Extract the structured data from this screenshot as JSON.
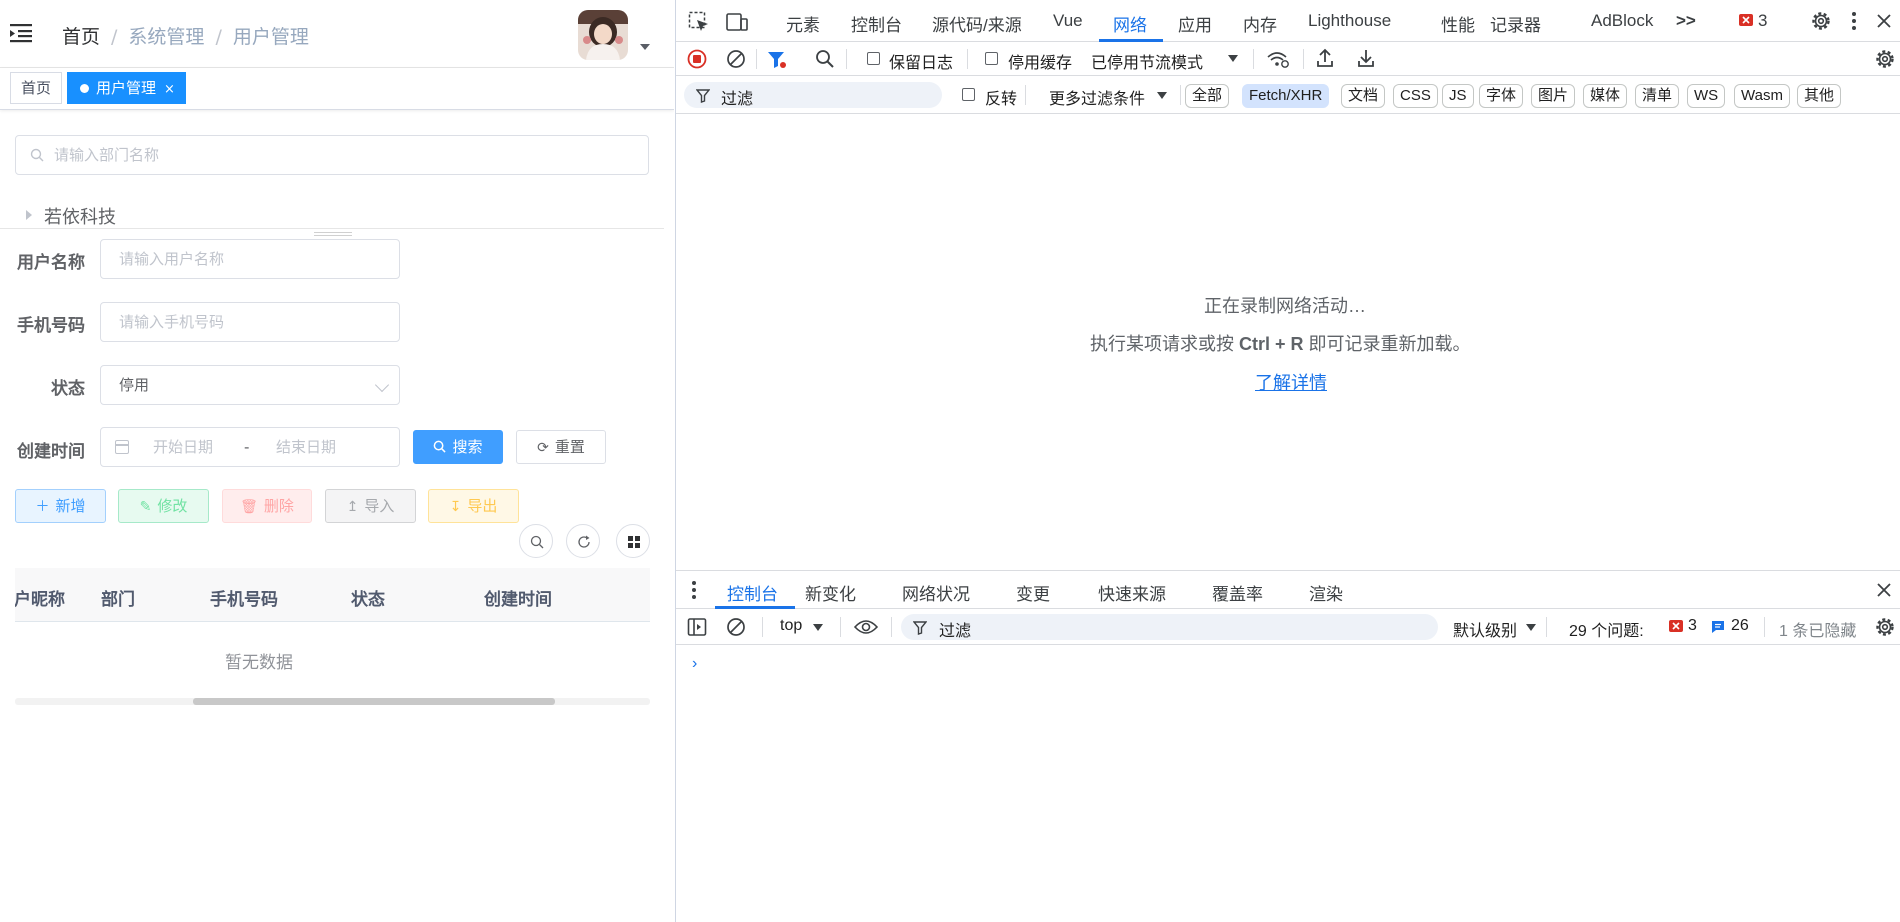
{
  "navbar": {
    "breadcrumb": [
      "首页",
      "系统管理",
      "用户管理"
    ]
  },
  "tags": {
    "home": "首页",
    "active": "用户管理",
    "close": "×"
  },
  "dept": {
    "search_placeholder": "请输入部门名称",
    "tree_root": "若依科技"
  },
  "form": {
    "username_label": "用户名称",
    "username_placeholder": "请输入用户名称",
    "phone_label": "手机号码",
    "phone_placeholder": "请输入手机号码",
    "status_label": "状态",
    "status_value": "停用",
    "created_label": "创建时间",
    "start_placeholder": "开始日期",
    "range_sep": "-",
    "end_placeholder": "结束日期",
    "search_button": "搜索",
    "reset_button": "重置"
  },
  "actions": {
    "add": "新增",
    "edit": "修改",
    "delete": "删除",
    "import": "导入",
    "export": "导出"
  },
  "table": {
    "columns": [
      "用户昵称",
      "部门",
      "手机号码",
      "状态",
      "创建时间"
    ],
    "empty_text": "暂无数据"
  },
  "devtools": {
    "tabs": [
      "元素",
      "控制台",
      "源代码/来源",
      "Vue",
      "网络",
      "应用",
      "内存",
      "Lighthouse",
      "性能",
      "记录器",
      "AdBlock"
    ],
    "active_tab": "网络",
    "more_tabs": ">>",
    "error_count": "3",
    "toolbar": {
      "preserve_log": "保留日志",
      "disable_cache": "停用缓存",
      "throttle": "已停用节流模式"
    },
    "filter": {
      "placeholder": "过滤",
      "invert": "反转",
      "more_filters": "更多过滤条件",
      "chips": [
        "全部",
        "Fetch/XHR",
        "文档",
        "CSS",
        "JS",
        "字体",
        "图片",
        "媒体",
        "清单",
        "WS",
        "Wasm",
        "其他"
      ],
      "active_chip": "Fetch/XHR"
    },
    "network_empty": {
      "line1": "正在录制网络活动…",
      "line2_pre": "执行某项请求或按 ",
      "line2_key": "Ctrl + R",
      "line2_post": " 即可记录重新加载。",
      "link": "了解详情"
    },
    "drawer": {
      "tabs": [
        "控制台",
        "新变化",
        "网络状况",
        "变更",
        "快速来源",
        "覆盖率",
        "渲染"
      ],
      "active_tab": "控制台",
      "context": "top",
      "filter_placeholder": "过滤",
      "level": "默认级别",
      "issues_label": "29 个问题:",
      "issues_errors": "3",
      "issues_info": "26",
      "hidden": "1 条已隐藏",
      "prompt": "›"
    }
  },
  "colors": {
    "primary": "#409eff",
    "tag_active": "#1890ff",
    "devtools_accent": "#1a73e8",
    "error": "#d93025"
  }
}
